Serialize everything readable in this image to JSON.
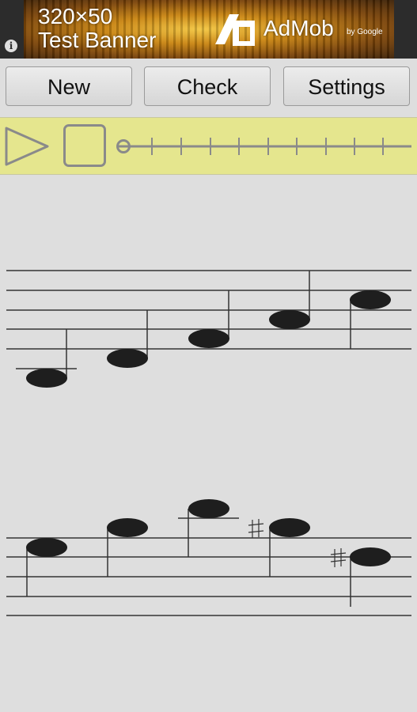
{
  "ad": {
    "title": "320×50",
    "subtitle": "Test Banner",
    "brand": "AdMob",
    "by": "by Google",
    "info_icon": "info-icon"
  },
  "toolbar": {
    "new_label": "New",
    "check_label": "Check",
    "settings_label": "Settings"
  },
  "player": {
    "play_icon": "play-icon",
    "stop_icon": "stop-icon",
    "position": 0
  },
  "colors": {
    "background": "#dedede",
    "player_bar": "#e5e68e",
    "staff_line": "#333333",
    "note": "#1e1e1e",
    "ad_bar": "#2c2c2c"
  }
}
